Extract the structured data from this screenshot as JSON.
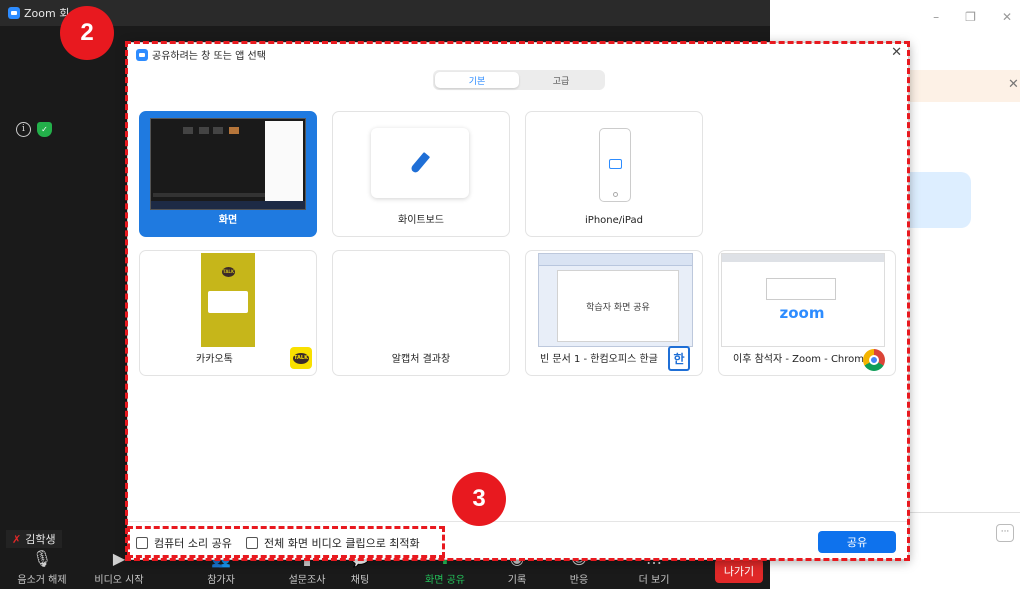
{
  "zoom": {
    "title": "Zoom 회",
    "participant_name": "김학생",
    "toolbar": {
      "unmute": "음소거 해제",
      "start_video": "비디오 시작",
      "participants": "참가자",
      "poll": "설문조사",
      "chat": "채팅",
      "share_screen": "화면 공유",
      "record": "기록",
      "reactions": "반응",
      "more": "더 보기",
      "leave": "나가기"
    }
  },
  "dialog": {
    "title": "공유하려는 창 또는 앱 선택",
    "tabs": [
      {
        "label": "기본",
        "active": true
      },
      {
        "label": "고급",
        "active": false
      }
    ],
    "cards": [
      {
        "label": "화면",
        "selected": true
      },
      {
        "label": "화이트보드"
      },
      {
        "label": "iPhone/iPad"
      },
      {
        "label": "카카오톡"
      },
      {
        "label": "알캡처 결과창"
      },
      {
        "label": "빈 문서 1 - 한컴오피스 한글",
        "thumb_text": "학습자 화면 공유"
      },
      {
        "label": "이후 참석자 - Zoom - Chrome",
        "thumb_logo": "zoom"
      }
    ],
    "footer": {
      "share_sound": "컴퓨터 소리 공유",
      "optimize_video": "전체 화면 비디오 클립으로 최적화",
      "share_button": "공유"
    }
  },
  "annotations": {
    "badge_2": "2",
    "badge_3": "3"
  },
  "colors": {
    "accent": "#0e72ed",
    "annotation": "#e8191f",
    "meeting_bg": "#1a1a1a",
    "active_share": "#23c25a"
  }
}
